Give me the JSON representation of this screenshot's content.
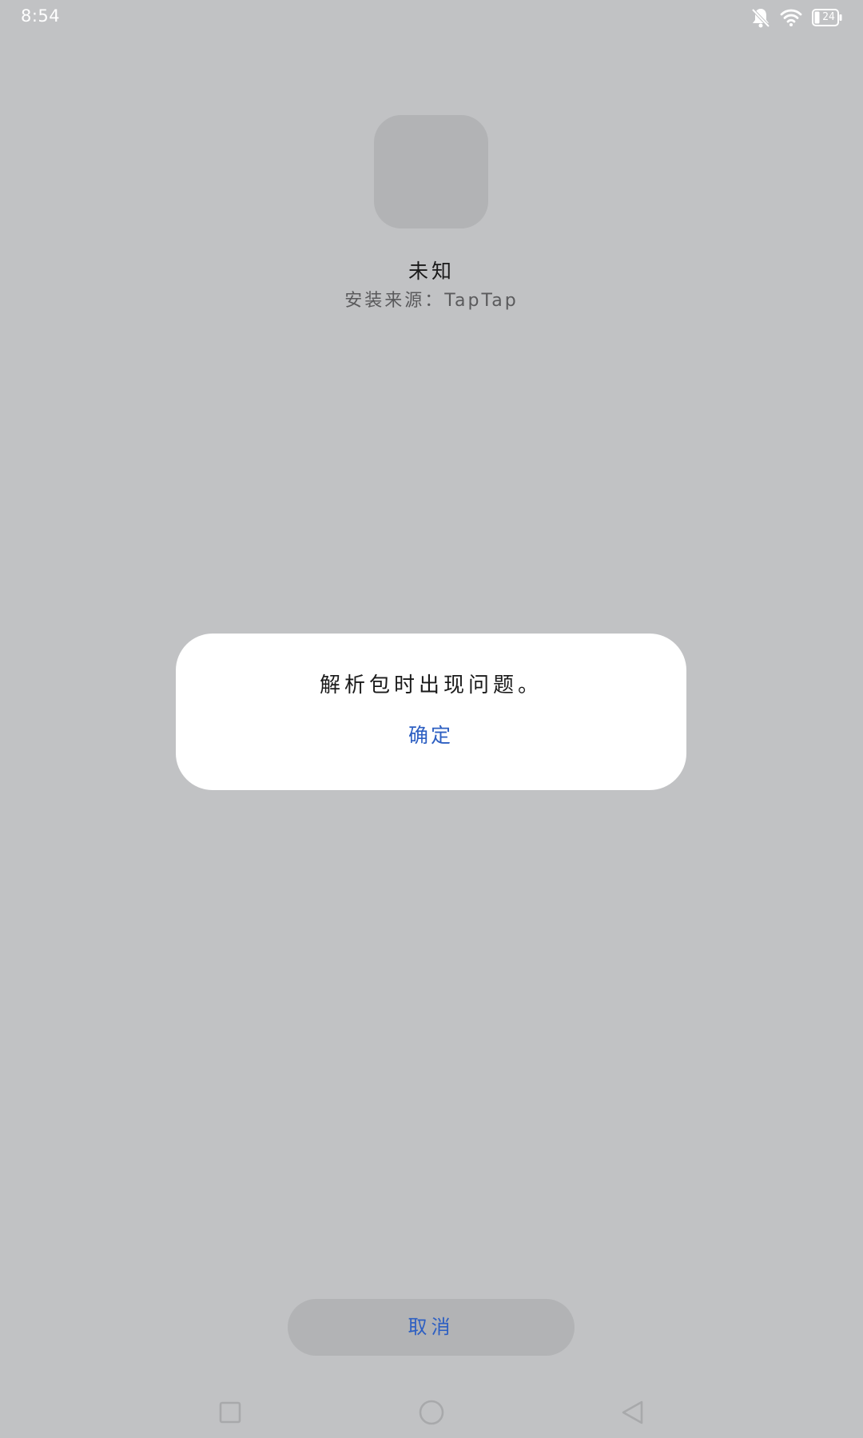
{
  "status_bar": {
    "time": "8:54",
    "battery_level": "24",
    "icons": [
      "bell-muted-icon",
      "wifi-icon",
      "battery-icon"
    ]
  },
  "app": {
    "name": "未知",
    "install_source": "安装来源：TapTap"
  },
  "dialog": {
    "message": "解析包时出现问题。",
    "ok_label": "确定"
  },
  "footer": {
    "cancel_label": "取消"
  },
  "nav_bar": {
    "icons": [
      "recent-apps-icon",
      "home-icon",
      "back-icon"
    ]
  },
  "colors": {
    "background": "#c1c2c4",
    "accent": "#2d5fc2",
    "surface": "#ffffff",
    "placeholder": "#b2b3b5"
  }
}
